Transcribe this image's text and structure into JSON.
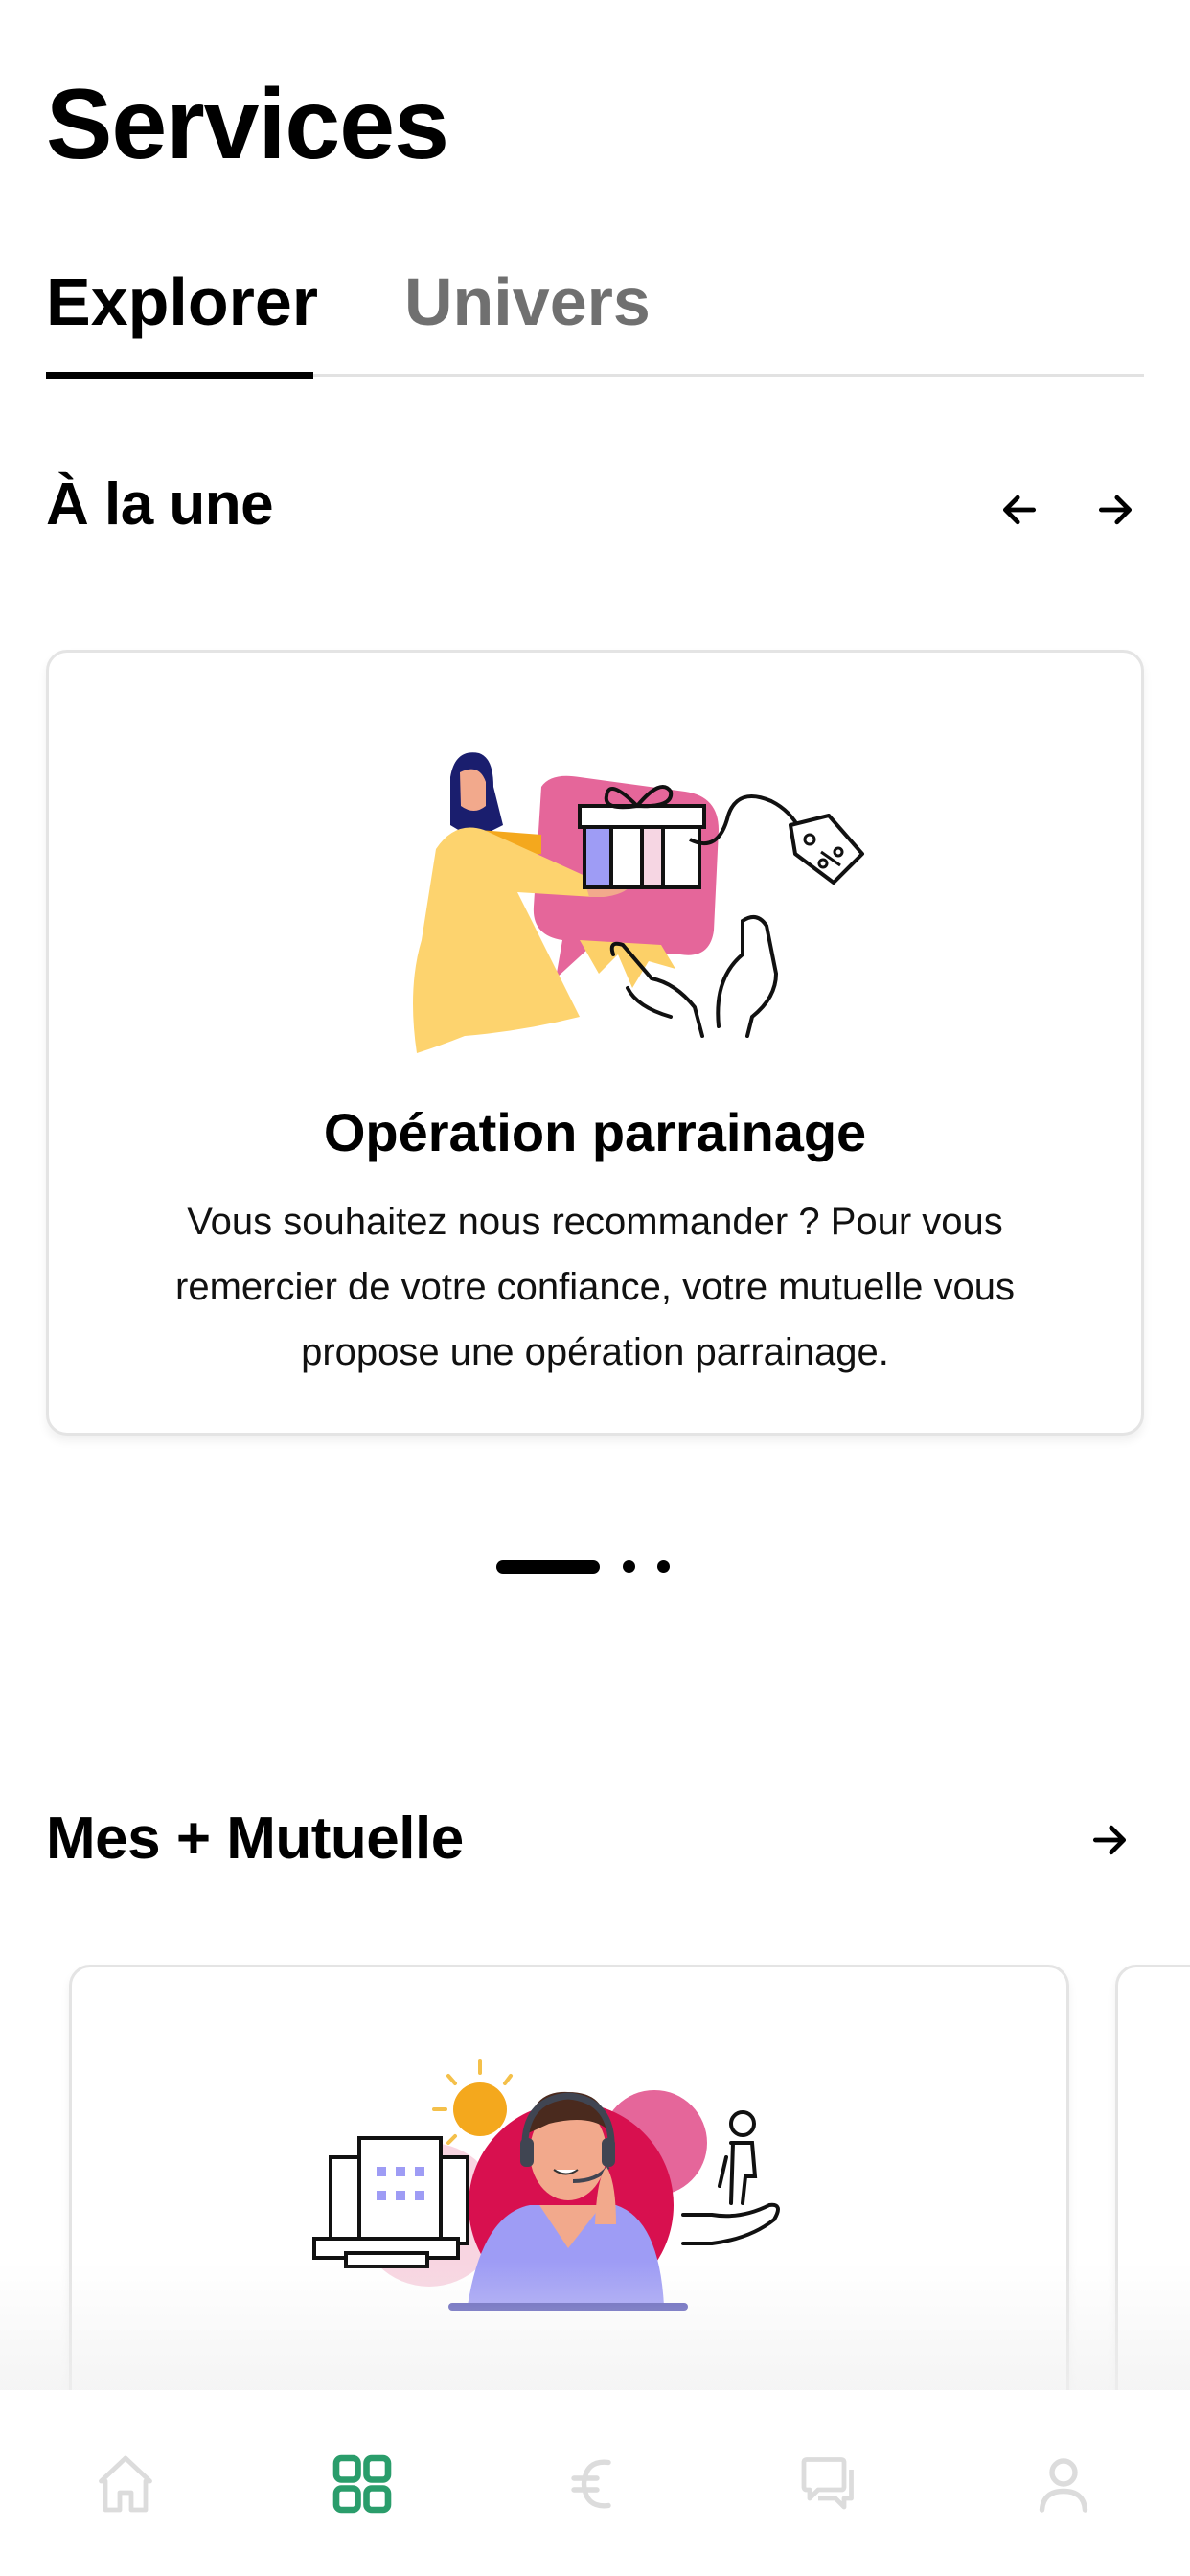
{
  "header": {
    "title": "Services"
  },
  "tabs": [
    {
      "label": "Explorer",
      "active": true
    },
    {
      "label": "Univers",
      "active": false
    }
  ],
  "featured": {
    "title": "À la une",
    "prev_icon": "arrow-left-icon",
    "next_icon": "arrow-right-icon",
    "card": {
      "title": "Opération parrainage",
      "description": "Vous souhaitez nous recommander ? Pour vous remercier de votre confiance, votre mutuelle vous propose une opération parrainage.",
      "illustration": "gift-referral-illustration"
    },
    "pagination": {
      "total": 3,
      "current": 1
    }
  },
  "mutuelle": {
    "title": "Mes + Mutuelle",
    "next_icon": "arrow-right-icon",
    "card": {
      "illustration": "teleconsultation-illustration"
    }
  },
  "bottom_nav": {
    "active_color": "#2A9D6B",
    "inactive_color": "#DCDCDC",
    "items": [
      {
        "icon": "home-icon",
        "active": false
      },
      {
        "icon": "grid-icon",
        "active": true
      },
      {
        "icon": "euro-icon",
        "active": false
      },
      {
        "icon": "chat-icon",
        "active": false
      },
      {
        "icon": "profile-icon",
        "active": false
      }
    ]
  },
  "colors": {
    "text_primary": "#000000",
    "tab_inactive": "#707070",
    "card_border": "#E4E4E4",
    "accent_green": "#2A9D6B"
  }
}
